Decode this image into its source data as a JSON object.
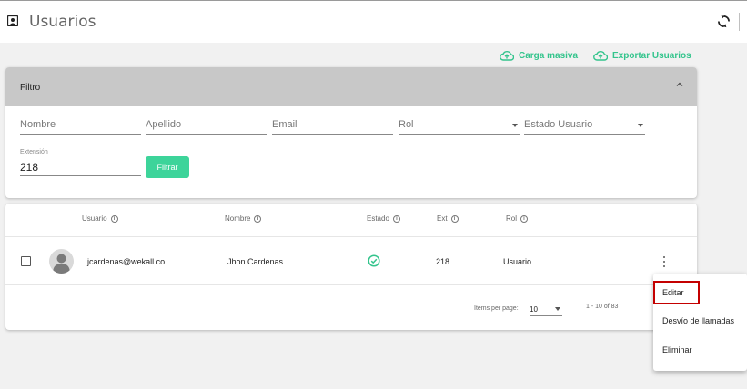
{
  "header": {
    "title": "Usuarios",
    "title_icon": "contact-card-icon",
    "refresh_icon": "refresh-icon"
  },
  "actions": {
    "bulk_upload": "Carga masiva",
    "export_users": "Exportar Usuarios",
    "icon": "cloud-upload-icon"
  },
  "filter": {
    "label": "Filtro",
    "fields": {
      "nombre": "Nombre",
      "apellido": "Apellido",
      "email": "Email",
      "rol": "Rol",
      "estado": "Estado Usuario"
    },
    "extension": {
      "label": "Extensión",
      "value": "218"
    },
    "button": "Filtrar"
  },
  "table": {
    "headers": {
      "usuario": "Usuario",
      "nombre": "Nombre",
      "estado": "Estado",
      "ext": "Ext",
      "rol": "Rol"
    },
    "rows": [
      {
        "usuario": "jcardenas@wekall.co",
        "nombre": "Jhon Cardenas",
        "estado": "active",
        "ext": "218",
        "rol": "Usuario"
      }
    ],
    "pagination": {
      "items_label": "Items per page:",
      "page_size": "10",
      "range": "1 - 10 of 83"
    }
  },
  "row_menu": {
    "items": [
      "Editar",
      "Desvío de llamadas",
      "Eliminar"
    ],
    "highlighted": "Editar"
  },
  "colors": {
    "accent": "#33c48c",
    "button": "#3dd49a",
    "highlight": "#c40000"
  }
}
